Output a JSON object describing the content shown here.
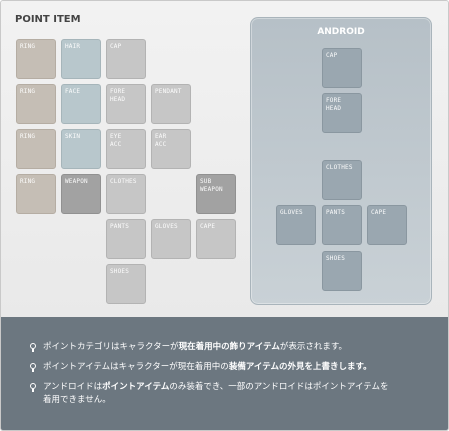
{
  "point_item": {
    "title": "POINT ITEM",
    "slots": {
      "ring1": "RING",
      "hair": "HAIR",
      "cap": "CAP",
      "ring2": "RING",
      "face": "FACE",
      "forehead": "FORE\nHEAD",
      "pendant": "PENDANT",
      "ring3": "RING",
      "skin": "SKIN",
      "eye_acc": "EYE\nACC",
      "ear_acc": "EAR\nACC",
      "ring4": "RING",
      "weapon": "WEAPON",
      "clothes": "CLOTHES",
      "sub_weapon": "SUB\nWEAPON",
      "pants": "PANTS",
      "gloves": "GLOVES",
      "cape": "CAPE",
      "shoes": "SHOES"
    }
  },
  "android": {
    "title": "ANDROID",
    "slots": {
      "cap": "CAP",
      "forehead": "FORE\nHEAD",
      "clothes": "CLOTHES",
      "gloves": "GLOVES",
      "pants": "PANTS",
      "cape": "CAPE",
      "shoes": "SHOES"
    }
  },
  "notes": {
    "note1": {
      "pre": "ポイントカテゴリはキャラクターが",
      "bold": "現在着用中の飾りアイテム",
      "post": "が表示されます。"
    },
    "note2": {
      "pre": "ポイントアイテムはキャラクターが現在着用中の",
      "bold": "装備アイテムの外見を上書きします。",
      "post": ""
    },
    "note3": {
      "pre": "アンドロイドは",
      "bold": "ポイントアイテム",
      "post": "のみ装着でき、一部のアンドロイドはポイントアイテムを",
      "line2": "着用できません。"
    }
  }
}
